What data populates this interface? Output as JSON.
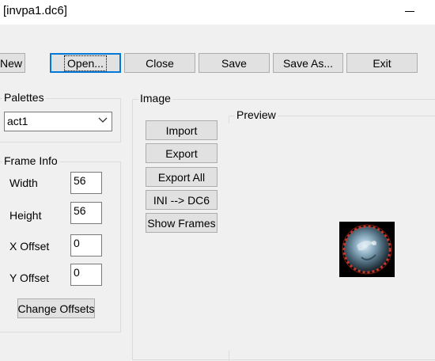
{
  "window": {
    "title": "[invpa1.dc6]",
    "minimize_icon": "minimize-icon"
  },
  "toolbar": {
    "new_label": "New",
    "open_label": "Open...",
    "close_label": "Close",
    "save_label": "Save",
    "save_as_label": "Save As...",
    "exit_label": "Exit"
  },
  "palettes": {
    "group_label": "Palettes",
    "selected": "act1",
    "dropdown_icon": "chevron-down-icon"
  },
  "frame_info": {
    "group_label": "Frame Info",
    "width_label": "Width",
    "width_value": "56",
    "height_label": "Height",
    "height_value": "56",
    "x_offset_label": "X Offset",
    "x_offset_value": "0",
    "y_offset_label": "Y Offset",
    "y_offset_value": "0",
    "change_offsets_label": "Change Offsets"
  },
  "image": {
    "group_label": "Image",
    "import_label": "Import",
    "export_label": "Export",
    "export_all_label": "Export All",
    "ini_to_dc6_label": "INI --> DC6",
    "show_frames_label": "Show Frames"
  },
  "preview": {
    "group_label": "Preview",
    "image_name": "amulet-preview-image"
  },
  "colors": {
    "background": "#f0f0f0",
    "button_face": "#e1e1e1",
    "button_border": "#adadad",
    "focus_accent": "#0078d7",
    "preview_bg": "#000000",
    "amulet_rim": "#c0392b"
  }
}
